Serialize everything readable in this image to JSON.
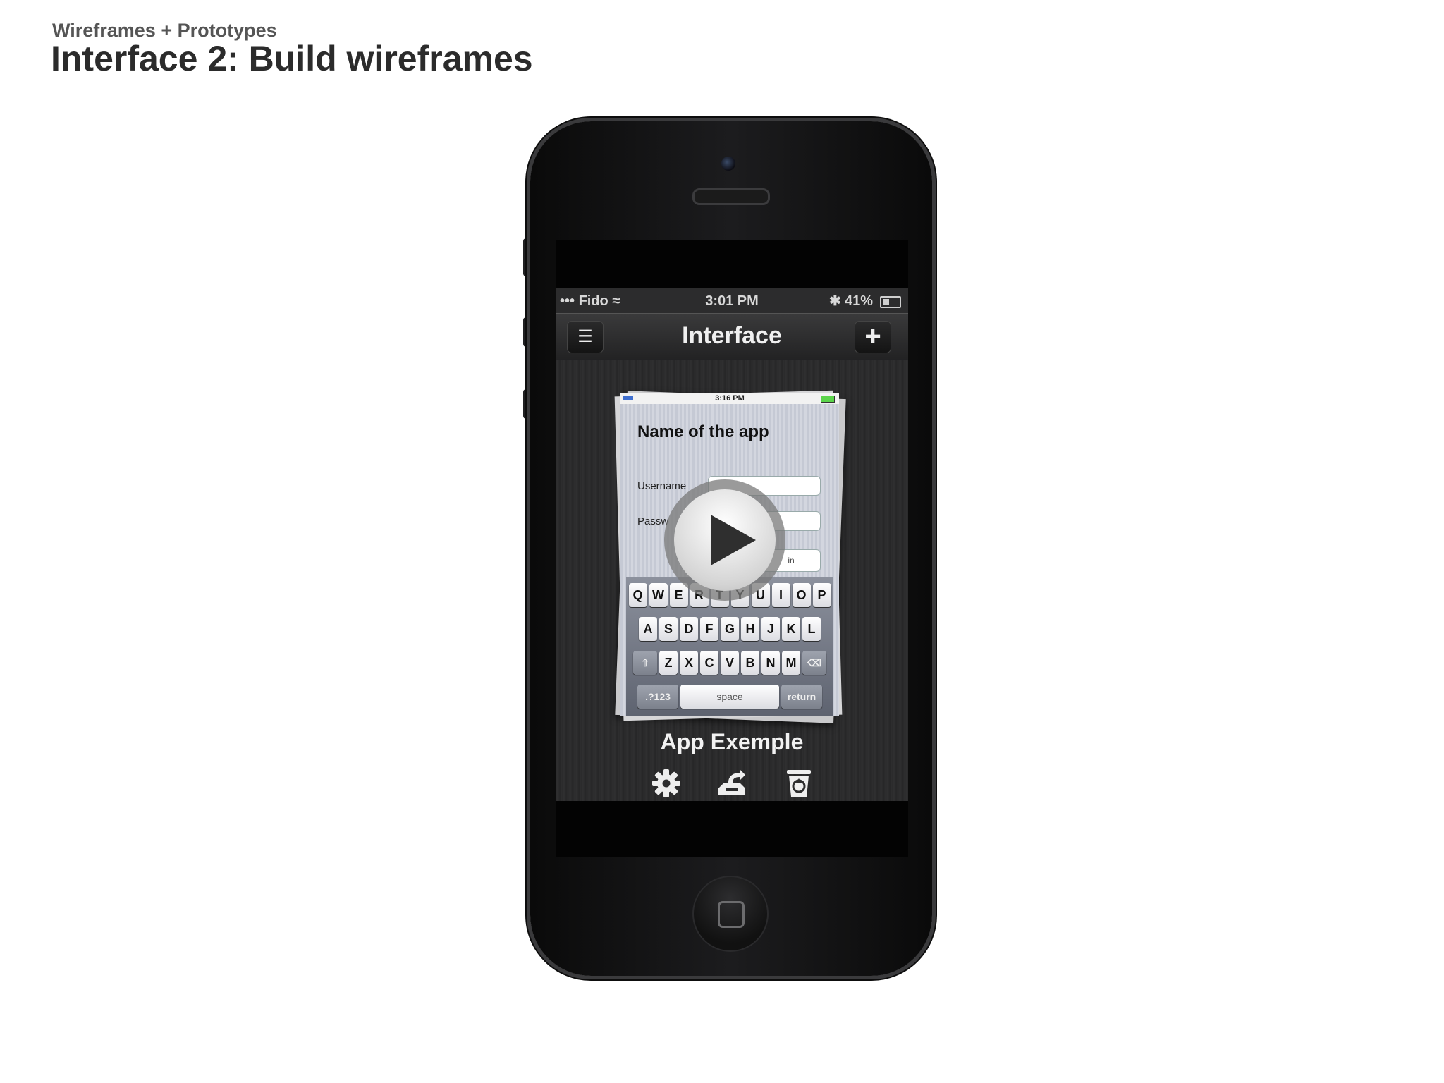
{
  "slide": {
    "subtitle": "Wireframes + Prototypes",
    "title": "Interface 2: Build wireframes"
  },
  "status_bar": {
    "carrier": "••• Fido ≈",
    "time": "3:01 PM",
    "bluetooth": "✱",
    "battery": "41%"
  },
  "navbar": {
    "title": "Interface",
    "left_icon": "list-icon",
    "right_icon": "plus-icon",
    "left_glyph": "☰",
    "right_glyph": "+"
  },
  "wireframe": {
    "status_time": "3:16 PM",
    "app_name": "Name of the app",
    "username_label": "Username",
    "password_label": "Passw",
    "login_label": "in",
    "keyboard": {
      "row1": [
        "Q",
        "W",
        "E",
        "R",
        "T",
        "Y",
        "U",
        "I",
        "O",
        "P"
      ],
      "row2": [
        "A",
        "S",
        "D",
        "F",
        "G",
        "H",
        "J",
        "K",
        "L"
      ],
      "row3": [
        "Z",
        "X",
        "C",
        "V",
        "B",
        "N",
        "M"
      ],
      "numbers_key": ".?123",
      "space_key": "space",
      "return_key": "return",
      "shift_glyph": "⇧",
      "delete_glyph": "⌫"
    }
  },
  "app_label": "App Exemple",
  "actions": [
    "gear-icon",
    "share-icon",
    "recycle-bin-icon"
  ],
  "colors": {
    "background": "#ffffff",
    "title": "#2b2b2b",
    "subtitle": "#555555",
    "phone_body": "#111111",
    "screen_bg": "#2c2c2d"
  }
}
